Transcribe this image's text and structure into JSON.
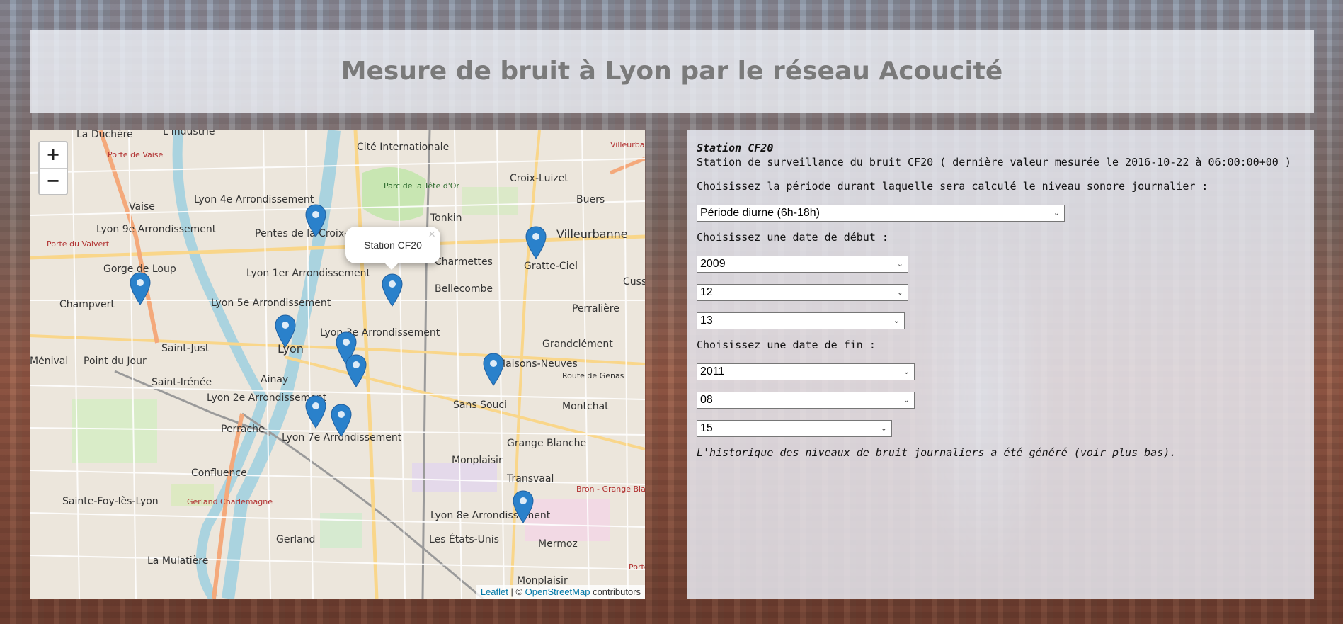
{
  "header": {
    "title": "Mesure de bruit à Lyon par le réseau Acoucité"
  },
  "map": {
    "zoom_in": "+",
    "zoom_out": "−",
    "popup": {
      "text": "Station CF20",
      "close": "×"
    },
    "labels": [
      "La Duchère",
      "L'Industrie",
      "Cité Internationale",
      "Villeurbanne So",
      "Porte de Vaise",
      "Croix-Luizet",
      "Vaise",
      "Lyon 4e Arrondissement",
      "Parc de la Tête d'Or",
      "Tonkin",
      "Buers",
      "Lyon 9e Arrondissement",
      "Pentes de la Croix-Rousse",
      "Villeurbanne",
      "Porte du Valvert",
      "Charmettes",
      "Gorge de Loup",
      "Lyon 1er Arrondissement",
      "Gratte-Ciel",
      "Bellecombe",
      "Cuss",
      "Champvert",
      "Lyon 5e Arrondissement",
      "Perralière",
      "Lyon 3e Arrondissement",
      "Lyon",
      "Grandclément",
      "Ménival",
      "Point du Jour",
      "Saint-Just",
      "Maisons-Neuves",
      "Saint-Irénée",
      "Ainay",
      "Route de Genas",
      "Lyon 2e Arrondissement",
      "Montchat",
      "Sans Souci",
      "Perrache",
      "Lyon 7e Arrondissement",
      "Grange Blanche",
      "Confluence",
      "Monplaisir",
      "Transvaal",
      "Sainte-Foy-lès-Lyon",
      "Gerland Charlemagne",
      "Bron - Grange Blanche",
      "Lyon 8e Arrondissement",
      "Gerland",
      "Les États-Unis",
      "Mermoz",
      "La Mulatière",
      "Monplaisir",
      "Porte de Lyon"
    ],
    "attribution": {
      "leaflet": "Leaflet",
      "sep": " | © ",
      "osm": "OpenStreetMap",
      "rest": " contributors"
    }
  },
  "panel": {
    "station_title": "Station CF20",
    "station_desc": "Station de surveillance du bruit CF20 ( dernière valeur mesurée le 2016-10-22 à 06:00:00+00 )",
    "period_label": "Choisissez la période durant laquelle sera calculé le niveau sonore journalier :",
    "period_value": "Période diurne (6h-18h)",
    "start_label": "Choisissez une date de début :",
    "start_year": "2009",
    "start_month": "12",
    "start_day": "13",
    "end_label": "Choisissez une date de fin :",
    "end_year": "2011",
    "end_month": "08",
    "end_day": "15",
    "note": "L'historique des niveaux de bruit journaliers a été généré (voir plus bas)."
  }
}
